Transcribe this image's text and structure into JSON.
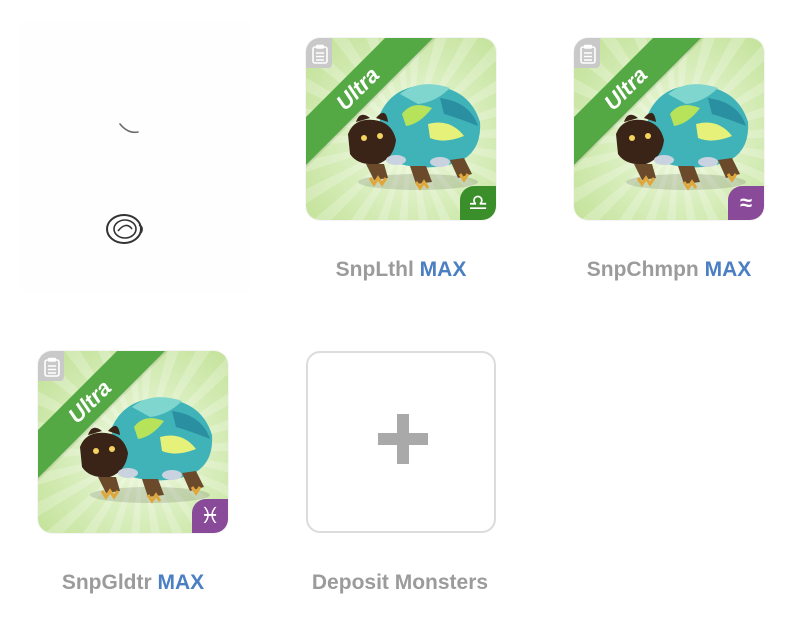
{
  "slots": [
    {
      "name": "SnpLthl",
      "level_tag": "MAX",
      "rarity": "Ultra",
      "badge_icon": "libra-icon",
      "badge_glyph": "♎",
      "badge_color": "#3b8f2a"
    },
    {
      "name": "SnpChmpn",
      "level_tag": "MAX",
      "rarity": "Ultra",
      "badge_icon": "aquarius-icon",
      "badge_glyph": "≈",
      "badge_color": "#8a4a9a"
    },
    {
      "name": "SnpGldtr",
      "level_tag": "MAX",
      "rarity": "Ultra",
      "badge_icon": "pisces-icon",
      "badge_glyph": "♓",
      "badge_color": "#8a4a9a"
    }
  ],
  "deposit": {
    "label": "Deposit Monsters",
    "icon": "plus-icon"
  },
  "colors": {
    "ribbon": "#55a944",
    "max_text": "#4a7fc4",
    "label_text": "#9b9b9b"
  }
}
